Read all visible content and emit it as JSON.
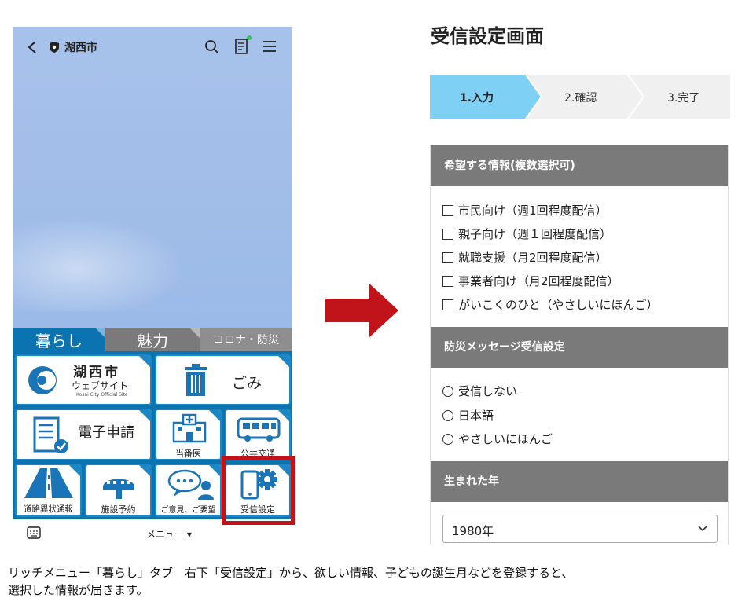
{
  "phone": {
    "header": {
      "city_name": "湖西市"
    },
    "tabs": [
      {
        "label": "暮らし",
        "active": true
      },
      {
        "label": "魅力",
        "active": false
      },
      {
        "label": "コロナ・防災",
        "active": false
      }
    ],
    "menu": {
      "web": {
        "title": "湖西市",
        "subtitle": "ウェブサイト",
        "en": "Kosai City Official Site"
      },
      "gomi": "ごみ",
      "denshi": "電子申請",
      "touban": "当番医",
      "koukyou": "公共交通",
      "douro": "道路異状通報",
      "shisetsu": "施設予約",
      "goiken": "ご意見、ご要望",
      "jushin": "受信設定"
    },
    "bottom": {
      "menu_label": "メニュー ▾"
    }
  },
  "colors": {
    "accent": "#0b74b0",
    "highlight": "#c0141a",
    "step_active": "#7fd0f5",
    "section_head": "#7a7a7a"
  },
  "form": {
    "title": "受信設定画面",
    "steps": [
      "1.入力",
      "2.確認",
      "3.完了"
    ],
    "sections": {
      "info": {
        "heading": "希望する情報(複数選択可)",
        "options": [
          "市民向け（週1回程度配信）",
          "親子向け（週１回程度配信）",
          "就職支援（月2回程度配信）",
          "事業者向け（月2回程度配信）",
          "がいこくのひと（やさしいにほんご）"
        ]
      },
      "bousai": {
        "heading": "防災メッセージ受信設定",
        "options": [
          "受信しない",
          "日本語",
          "やさしいにほんご"
        ]
      },
      "birth": {
        "heading": "生まれた年",
        "selected": "1980年"
      }
    }
  },
  "caption": {
    "line1": "リッチメニュー「暮らし」タブ　右下「受信設定」から、欲しい情報、子どもの誕生月などを登録すると、",
    "line2": "選択した情報が届きます。"
  }
}
